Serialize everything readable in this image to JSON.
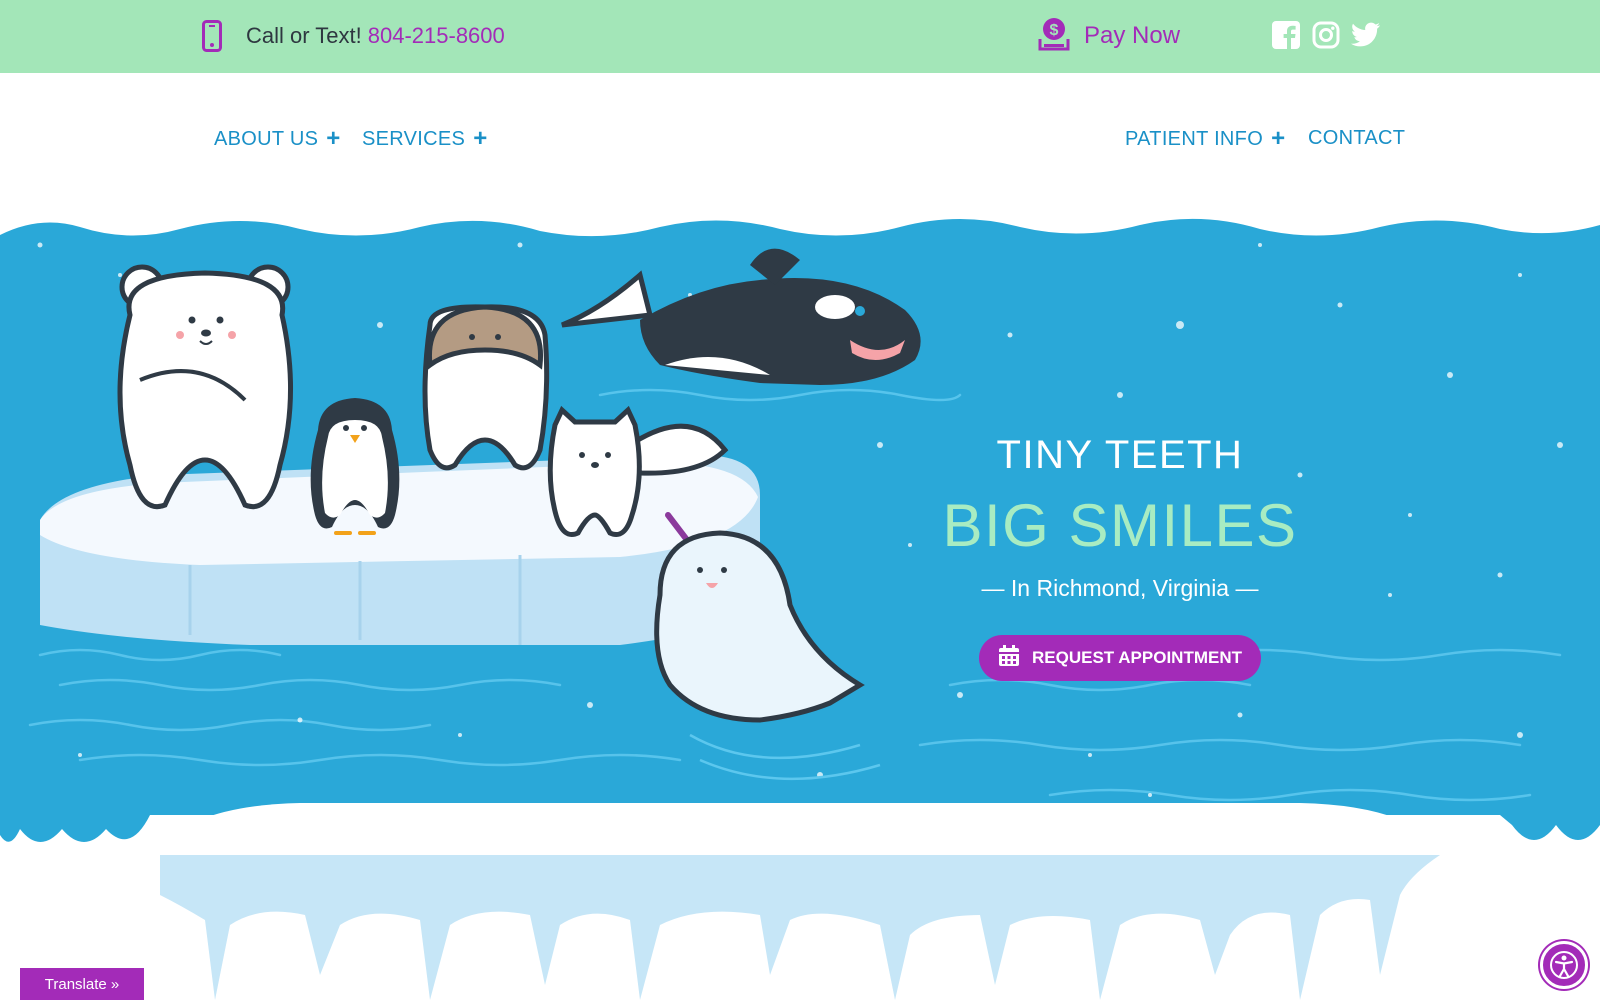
{
  "topbar": {
    "call_label": "Call or Text!",
    "phone": "804-215-8600",
    "pay_label": "Pay Now",
    "icons": [
      "phone-icon",
      "pay-icon",
      "facebook-icon",
      "instagram-icon",
      "twitter-icon"
    ]
  },
  "nav": {
    "items": [
      {
        "label": "ABOUT US",
        "has_submenu": true
      },
      {
        "label": "SERVICES",
        "has_submenu": true
      },
      {
        "label": "PATIENT INFO",
        "has_submenu": true
      },
      {
        "label": "CONTACT",
        "has_submenu": false
      }
    ],
    "plus": "+"
  },
  "hero": {
    "line1": "TINY TEETH",
    "line2": "BIG SMILES",
    "line3": "— In Richmond, Virginia —",
    "cta_label": "REQUEST APPOINTMENT",
    "cta_icon": "calendar-icon",
    "illustration": [
      "polar-bear-tooth",
      "penguin-tooth",
      "walrus-tooth",
      "arctic-fox-tooth",
      "orca",
      "narwhal-tooth",
      "ice-floe",
      "icicles"
    ]
  },
  "widgets": {
    "translate_label": "Translate »",
    "accessibility_icon": "accessibility-icon"
  },
  "colors": {
    "topbar_bg": "#a3e6b8",
    "accent_purple": "#a32bb8",
    "nav_blue": "#1a90c7",
    "ocean": "#2aa8d8",
    "mint": "#a8ecc2"
  }
}
